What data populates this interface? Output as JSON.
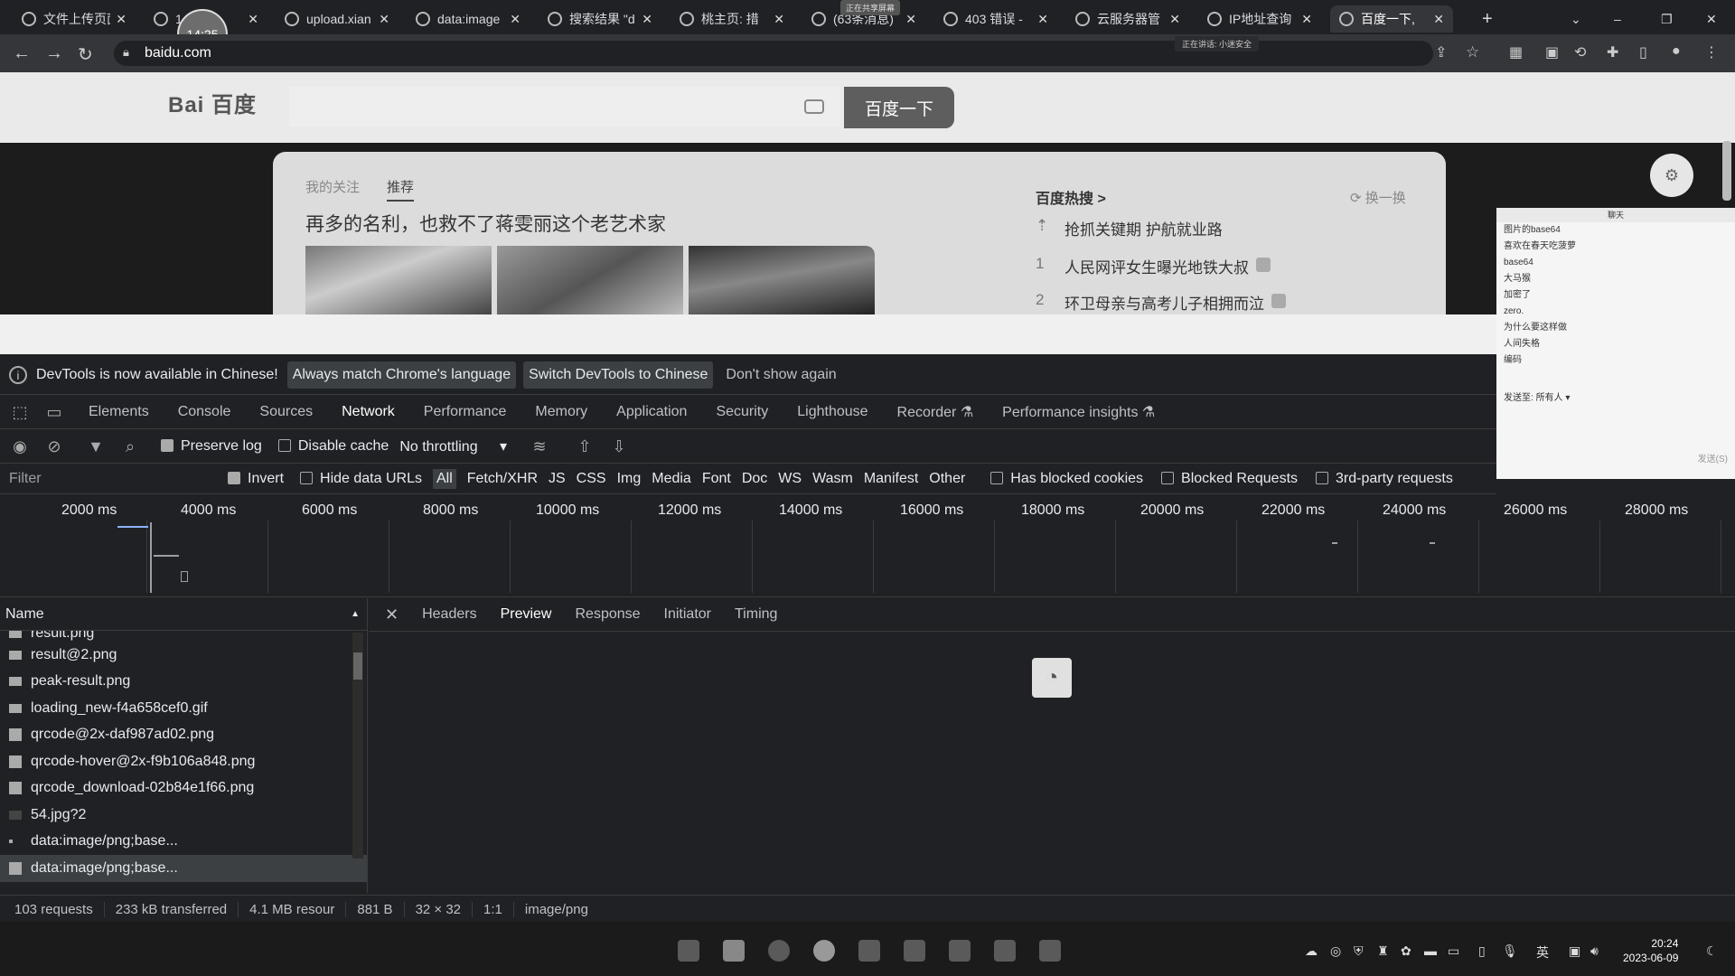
{
  "browser": {
    "tabs": [
      {
        "label": "文件上传页面"
      },
      {
        "label": "1.4"
      },
      {
        "label": "upload.xian"
      },
      {
        "label": "data:image"
      },
      {
        "label": "搜索结果 \"d"
      },
      {
        "label": "桃主页: 措"
      },
      {
        "label": "(63条消息)"
      },
      {
        "label": "403 错误 - "
      },
      {
        "label": "云服务器管"
      },
      {
        "label": "IP地址查询"
      },
      {
        "label": "百度一下,"
      }
    ],
    "recording_timer": "14:25",
    "tab_tooltip": "正在共享屏幕",
    "url": "baidu.com",
    "share_note": "正在讲话: 小迷安全"
  },
  "baidu": {
    "logo": "Bai 百度",
    "search_button": "百度一下",
    "feed_tabs": [
      "我的关注",
      "推荐"
    ],
    "headline": "再多的名利，也救不了蒋雯丽这个老艺术家",
    "hot_title": "百度热搜 >",
    "hot_refresh": "换一换",
    "hot_items": [
      {
        "num": "⇡",
        "text": "抢抓关键期 护航就业路"
      },
      {
        "num": "1",
        "text": "人民网评女生曝光地铁大叔"
      },
      {
        "num": "2",
        "text": "环卫母亲与高考儿子相拥而泣"
      }
    ]
  },
  "chat": {
    "title": "聊天",
    "lines": [
      "图片的base64",
      "喜欢在春天吃菠萝",
      "base64",
      "大马猴",
      "加密了",
      "zero.",
      "为什么要这样做",
      "人间失格",
      "编码"
    ],
    "send_to_label": "发送至:",
    "send_to_value": "所有人",
    "send_btn": "发送(S)"
  },
  "devtools": {
    "infobar": {
      "text": "DevTools is now available in Chinese!",
      "btn_match": "Always match Chrome's language",
      "btn_switch": "Switch DevTools to Chinese",
      "dismiss": "Don't show again"
    },
    "panel_tabs": [
      "Elements",
      "Console",
      "Sources",
      "Network",
      "Performance",
      "Memory",
      "Application",
      "Security",
      "Lighthouse",
      "Recorder",
      "Performance insights"
    ],
    "toolbar": {
      "preserve_log": "Preserve log",
      "disable_cache": "Disable cache",
      "throttling": "No throttling"
    },
    "filter": {
      "placeholder": "Filter",
      "invert": "Invert",
      "hide_data_urls": "Hide data URLs",
      "types": [
        "All",
        "Fetch/XHR",
        "JS",
        "CSS",
        "Img",
        "Media",
        "Font",
        "Doc",
        "WS",
        "Wasm",
        "Manifest",
        "Other"
      ],
      "has_blocked_cookies": "Has blocked cookies",
      "blocked_requests": "Blocked Requests",
      "third_party": "3rd-party requests"
    },
    "timeline_ticks": [
      "2000 ms",
      "4000 ms",
      "6000 ms",
      "8000 ms",
      "10000 ms",
      "12000 ms",
      "14000 ms",
      "16000 ms",
      "18000 ms",
      "20000 ms",
      "22000 ms",
      "24000 ms",
      "26000 ms",
      "28000 ms"
    ],
    "name_header": "Name",
    "requests": [
      "result.png",
      "result@2.png",
      "peak-result.png",
      "loading_new-f4a658cef0.gif",
      "qrcode@2x-daf987ad02.png",
      "qrcode-hover@2x-f9b106a848.png",
      "qrcode_download-02b84e1f66.png",
      "54.jpg?2",
      "data:image/png;base...",
      "data:image/png;base..."
    ],
    "detail_tabs": [
      "Headers",
      "Preview",
      "Response",
      "Initiator",
      "Timing"
    ],
    "status": {
      "requests": "103 requests",
      "transferred": "233 kB transferred",
      "resources": "4.1 MB resour",
      "size": "881 B",
      "dimensions": "32 × 32",
      "ratio": "1:1",
      "mime": "image/png"
    }
  },
  "taskbar": {
    "tray_lang": "英",
    "time": "20:24",
    "date": "2023-06-09"
  }
}
